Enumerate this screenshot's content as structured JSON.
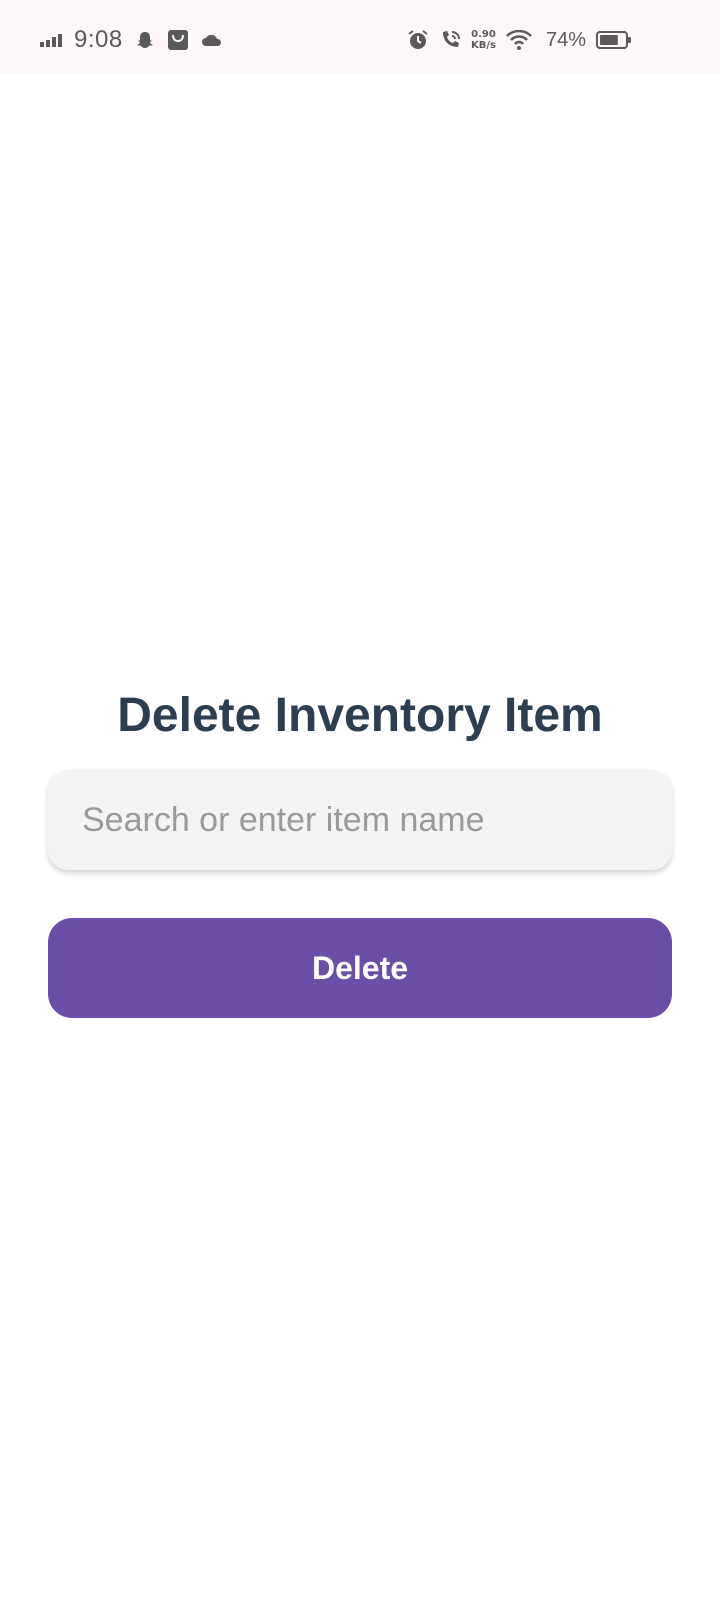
{
  "status_bar": {
    "time": "9:08",
    "net_speed_value": "0.90",
    "net_speed_unit": "KB/s",
    "battery_percent": "74%",
    "battery_level": 0.74,
    "icons": [
      "signal-icon",
      "snapchat-icon",
      "shopping-bag-icon",
      "cloud-icon",
      "alarm-icon",
      "wifi-call-icon",
      "wifi-icon",
      "battery-icon"
    ]
  },
  "main": {
    "title": "Delete Inventory Item",
    "search": {
      "placeholder": "Search or enter item name",
      "value": ""
    },
    "delete_label": "Delete"
  },
  "colors": {
    "title": "#2c3e50",
    "button": "#6b4fa6",
    "status_bar_bg": "#fdf7fc"
  }
}
